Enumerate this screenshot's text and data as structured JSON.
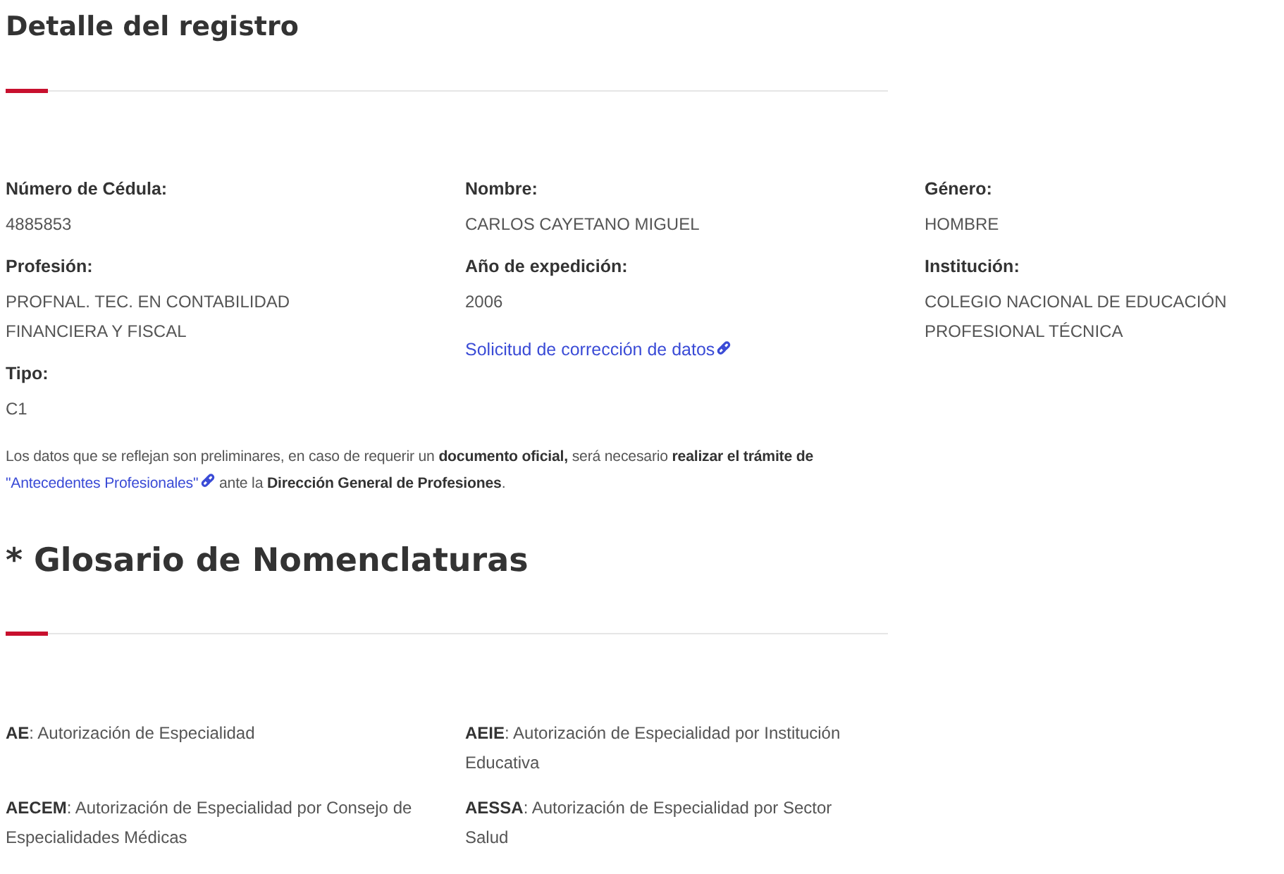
{
  "record": {
    "title": "Detalle del registro",
    "columns": [
      [
        {
          "kind": "field",
          "label": "Número de Cédula:",
          "value": "4885853"
        },
        {
          "kind": "field",
          "label": "Profesión:",
          "value": "PROFNAL. TEC. EN CONTABILIDAD FINANCIERA Y FISCAL"
        },
        {
          "kind": "field",
          "label": "Tipo:",
          "value": "C1"
        }
      ],
      [
        {
          "kind": "field",
          "label": "Nombre:",
          "value": "CARLOS CAYETANO MIGUEL"
        },
        {
          "kind": "field",
          "label": "Año de expedición:",
          "value": "2006"
        },
        {
          "kind": "link",
          "text": "Solicitud de corrección de datos"
        }
      ],
      [
        {
          "kind": "field",
          "label": "Género:",
          "value": "HOMBRE"
        },
        {
          "kind": "field",
          "label": "Institución:",
          "value": "COLEGIO NACIONAL DE EDUCACIÓN PROFESIONAL TÉCNICA"
        }
      ]
    ],
    "notice": {
      "before": "Los datos que se reflejan son preliminares, en caso de requerir un **documento oficial,** será necesario **realizar el trámite de** ",
      "link": "\"Antecedentes Profesionales\"",
      "after": " ante la **Dirección General de Profesiones**."
    }
  },
  "glossary": {
    "title": "* Glosario de Nomenclaturas",
    "items": [
      {
        "text": "**AE**: Autorización de Especialidad"
      },
      {
        "text": "**AEIE**: Autorización de Especialidad por Institución Educativa"
      },
      {
        "text": "**AECEM**: Autorización de Especialidad por Consejo de Especialidades Médicas"
      },
      {
        "text": "**AESSA**: Autorización de Especialidad por Sector Salud"
      }
    ]
  }
}
